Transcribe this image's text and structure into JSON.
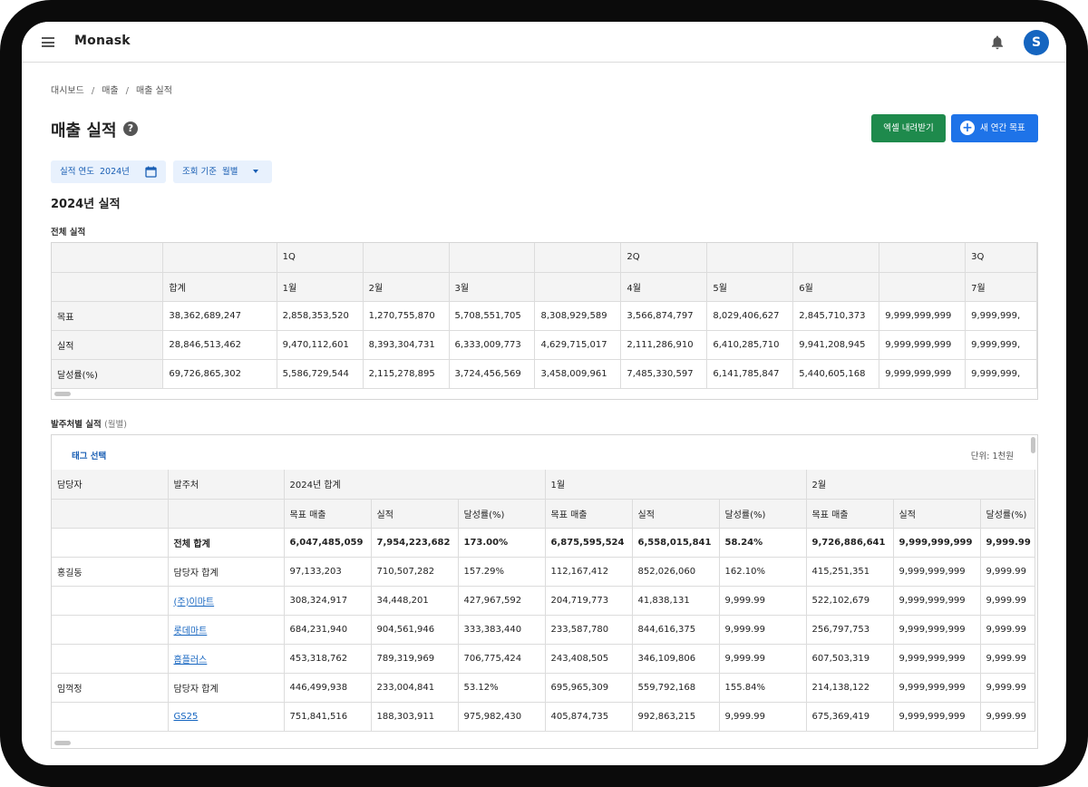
{
  "app": {
    "name": "Monask",
    "avatar_initial": "S"
  },
  "breadcrumb": [
    "대시보드",
    "매출",
    "매출 실적"
  ],
  "page": {
    "title": "매출 실적",
    "help_glyph": "?"
  },
  "actions": {
    "excel": "엑셀 내려받기",
    "new_goal": "새 연간 목표"
  },
  "filters": {
    "year_label": "실적 연도",
    "year_value": "2024년",
    "basis_label": "조회 기준",
    "basis_value": "월별"
  },
  "section_title": "2024년 실적",
  "overall": {
    "title": "전체 실적",
    "quarter_row": [
      "",
      "",
      "1Q",
      "",
      "",
      "",
      "2Q",
      "",
      "",
      "",
      "3Q"
    ],
    "month_row": [
      "",
      "합계",
      "1월",
      "2월",
      "3월",
      "",
      "4월",
      "5월",
      "6월",
      "",
      "7월"
    ],
    "rows": [
      {
        "label": "목표",
        "values": [
          "38,362,689,247",
          "2,858,353,520",
          "1,270,755,870",
          "5,708,551,705",
          "8,308,929,589",
          "3,566,874,797",
          "8,029,406,627",
          "2,845,710,373",
          "9,999,999,999",
          "9,999,999,"
        ]
      },
      {
        "label": "실적",
        "values": [
          "28,846,513,462",
          "9,470,112,601",
          "8,393,304,731",
          "6,333,009,773",
          "4,629,715,017",
          "2,111,286,910",
          "6,410,285,710",
          "9,941,208,945",
          "9,999,999,999",
          "9,999,999,"
        ]
      },
      {
        "label": "달성률(%)",
        "values": [
          "69,726,865,302",
          "5,586,729,544",
          "2,115,278,895",
          "3,724,456,569",
          "3,458,009,961",
          "7,485,330,597",
          "6,141,785,847",
          "5,440,605,168",
          "9,999,999,999",
          "9,999,999,"
        ]
      }
    ]
  },
  "by_client": {
    "title": "발주처별 실적",
    "title_suffix": "(월별)",
    "tag_select": "태그 선택",
    "unit": "단위: 1천원",
    "group_row": [
      "담당자",
      "발주처",
      "2024년 합계",
      "1월",
      "2월"
    ],
    "sub_row": [
      "",
      "",
      "목표 매출",
      "실적",
      "달성률(%)",
      "목표 매출",
      "실적",
      "달성률(%)",
      "목표 매출",
      "실적",
      "달성률(%)"
    ],
    "rows": [
      {
        "manager": "",
        "client": "전체 합계",
        "link": false,
        "sum": false,
        "bold": true,
        "values": [
          "6,047,485,059",
          "7,954,223,682",
          "173.00%",
          "6,875,595,524",
          "6,558,015,841",
          "58.24%",
          "9,726,886,641",
          "9,999,999,999",
          "9,999.99"
        ]
      },
      {
        "manager": "홍길동",
        "client": "담당자 합계",
        "link": false,
        "sum": true,
        "bold": false,
        "values": [
          "97,133,203",
          "710,507,282",
          "157.29%",
          "112,167,412",
          "852,026,060",
          "162.10%",
          "415,251,351",
          "9,999,999,999",
          "9,999.99"
        ]
      },
      {
        "manager": "",
        "client": "(주)이마트",
        "link": true,
        "sum": false,
        "bold": false,
        "values": [
          "308,324,917",
          "34,448,201",
          "427,967,592",
          "204,719,773",
          "41,838,131",
          "9,999.99",
          "522,102,679",
          "9,999,999,999",
          "9,999.99"
        ]
      },
      {
        "manager": "",
        "client": "롯데마트",
        "link": true,
        "sum": false,
        "bold": false,
        "values": [
          "684,231,940",
          "904,561,946",
          "333,383,440",
          "233,587,780",
          "844,616,375",
          "9,999.99",
          "256,797,753",
          "9,999,999,999",
          "9,999.99"
        ]
      },
      {
        "manager": "",
        "client": "홈플러스",
        "link": true,
        "sum": false,
        "bold": false,
        "values": [
          "453,318,762",
          "789,319,969",
          "706,775,424",
          "243,408,505",
          "346,109,806",
          "9,999.99",
          "607,503,319",
          "9,999,999,999",
          "9,999.99"
        ]
      },
      {
        "manager": "임꺽정",
        "client": "담당자 합계",
        "link": false,
        "sum": true,
        "bold": false,
        "values": [
          "446,499,938",
          "233,004,841",
          "53.12%",
          "695,965,309",
          "559,792,168",
          "155.84%",
          "214,138,122",
          "9,999,999,999",
          "9,999.99"
        ]
      },
      {
        "manager": "",
        "client": "GS25",
        "link": true,
        "sum": false,
        "bold": false,
        "values": [
          "751,841,516",
          "188,303,911",
          "975,982,430",
          "405,874,735",
          "992,863,215",
          "9,999.99",
          "675,369,419",
          "9,999,999,999",
          "9,999.99"
        ]
      }
    ]
  }
}
